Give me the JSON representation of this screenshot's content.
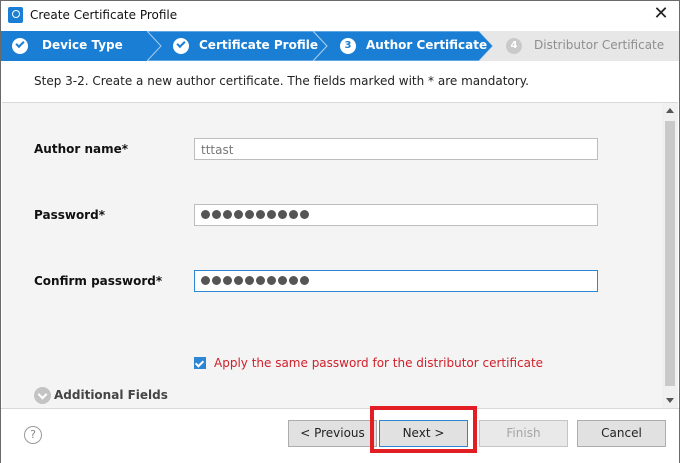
{
  "window": {
    "title": "Create Certificate Profile"
  },
  "steps": [
    {
      "label": "Device Type",
      "state": "done"
    },
    {
      "label": "Certificate Profile",
      "state": "done"
    },
    {
      "label": "Author Certificate",
      "state": "current",
      "number": "3"
    },
    {
      "label": "Distributor Certificate",
      "state": "pending",
      "number": "4"
    }
  ],
  "description": "Step 3-2. Create a new author certificate. The fields marked with * are mandatory.",
  "form": {
    "author_name": {
      "label": "Author name*",
      "value": "tttast"
    },
    "password": {
      "label": "Password*",
      "masked_length": 10
    },
    "confirm_password": {
      "label": "Confirm password*",
      "masked_length": 10
    },
    "apply_same_password": {
      "label": "Apply the same password for the distributor certificate",
      "checked": true
    },
    "additional_fields": {
      "label": "Additional Fields"
    }
  },
  "buttons": {
    "help": "?",
    "previous": "< Previous",
    "next": "Next >",
    "finish": "Finish",
    "cancel": "Cancel"
  },
  "colors": {
    "accent": "#1a7fd4",
    "highlight": "#e21d24",
    "warning_text": "#d0202a"
  }
}
